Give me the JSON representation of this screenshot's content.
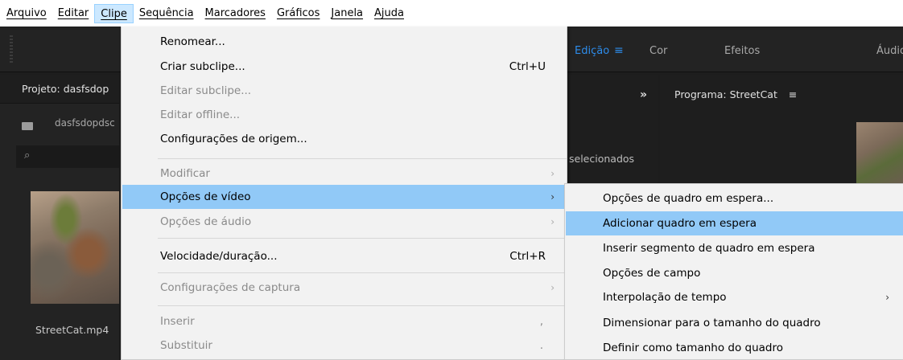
{
  "menubar": {
    "items": [
      {
        "label": "Arquivo"
      },
      {
        "label": "Editar"
      },
      {
        "label": "Clipe",
        "active": true
      },
      {
        "label": "Sequência"
      },
      {
        "label": "Marcadores"
      },
      {
        "label": "Gráficos"
      },
      {
        "label": "Janela"
      },
      {
        "label": "Ajuda"
      }
    ]
  },
  "workspaces": {
    "tabs": [
      "Edição",
      "Cor",
      "Efeitos",
      "Áudio"
    ],
    "active": "Edição",
    "menu_icon": "hamburger-icon"
  },
  "project_panel": {
    "title": "Projeto: dasfsdop",
    "folder_label": "dasfsdopdsc",
    "clip_name": "StreetCat.mp4"
  },
  "middle_panel": {
    "expand_label": "»",
    "selection_text": "selecionados"
  },
  "program_panel": {
    "title": "Programa: StreetCat",
    "menu_icon": "hamburger-icon"
  },
  "clip_menu": {
    "items": [
      {
        "label": "Renomear...",
        "shortcut": "",
        "disabled": false
      },
      {
        "label": "Criar subclipe...",
        "shortcut": "Ctrl+U",
        "disabled": false
      },
      {
        "label": "Editar subclipe...",
        "shortcut": "",
        "disabled": true
      },
      {
        "label": "Editar offline...",
        "shortcut": "",
        "disabled": true
      },
      {
        "label": "Configurações de origem...",
        "shortcut": "",
        "disabled": false
      },
      {
        "label": "Modificar",
        "submenu": true,
        "disabled": true
      },
      {
        "label": "Opções de vídeo",
        "submenu": true,
        "disabled": false,
        "highlighted": true
      },
      {
        "label": "Opções de áudio",
        "submenu": true,
        "disabled": true
      },
      {
        "label": "Velocidade/duração...",
        "shortcut": "Ctrl+R",
        "disabled": false
      },
      {
        "label": "Configurações de captura",
        "submenu": true,
        "disabled": true
      },
      {
        "label": "Inserir",
        "shortcut": ",",
        "disabled": true
      },
      {
        "label": "Substituir",
        "shortcut": ".",
        "disabled": true
      }
    ]
  },
  "video_submenu": {
    "items": [
      {
        "label": "Opções de quadro em espera..."
      },
      {
        "label": "Adicionar quadro em espera",
        "highlighted": true
      },
      {
        "label": "Inserir segmento de quadro em espera"
      },
      {
        "label": "Opções de campo"
      },
      {
        "label": "Interpolação de tempo",
        "submenu": true
      },
      {
        "label": "Dimensionar para o tamanho do quadro"
      },
      {
        "label": "Definir como tamanho do quadro"
      }
    ]
  },
  "colors": {
    "highlight": "#91c9f7",
    "menubar_active": "#cce8ff",
    "workspace_active": "#2d8ceb",
    "app_background": "#1d1d1d"
  }
}
